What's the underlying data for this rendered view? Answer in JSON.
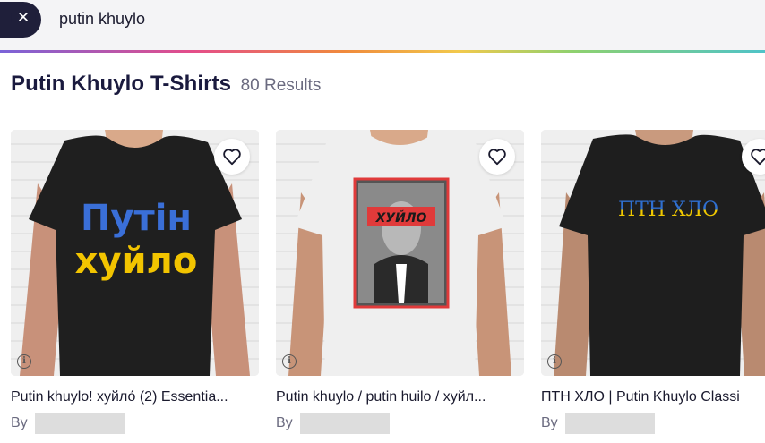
{
  "search": {
    "query": "putin khuylo",
    "clear_icon": "close-icon"
  },
  "results": {
    "title": "Putin Khuylo T-Shirts",
    "count": "80 Results"
  },
  "accent": {
    "gradient": [
      "#7a63d8",
      "#e44d8a",
      "#f08a3c",
      "#f2c94c",
      "#8ed16f",
      "#4fc3c8"
    ]
  },
  "products": [
    {
      "title": "Putin khuylo! хуйло́ (2) Essentia...",
      "by_label": "By",
      "shirt_color": "#222222",
      "print_lines": [
        "Путін",
        "хуйло"
      ],
      "print_colors": [
        "#3a6fd8",
        "#f2c400"
      ]
    },
    {
      "title": "Putin khuylo / putin huilo / хуйл...",
      "by_label": "By",
      "shirt_color": "#f2f2f2",
      "print_lines": [
        "ХУЙЛО"
      ],
      "print_colors": [
        "#e03a3a"
      ]
    },
    {
      "title": "ПТН ХЛО | Putin Khuylo Classi",
      "by_label": "By",
      "shirt_color": "#1e1e1e",
      "print_lines": [
        "ПТН ХЛО"
      ],
      "print_colors": [
        "#2f6fd0",
        "#f0c800"
      ]
    }
  ]
}
